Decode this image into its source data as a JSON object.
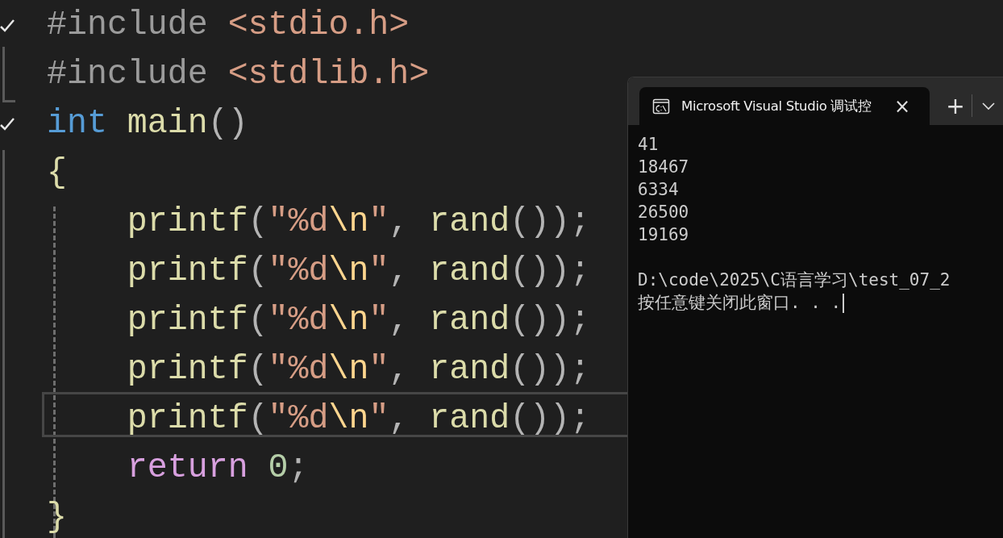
{
  "editor": {
    "lines": [
      {
        "checked": true,
        "current": false,
        "tokens": [
          {
            "kind": "preprocessor",
            "text": "#include"
          },
          {
            "kind": "string",
            "text": " <stdio.h>"
          }
        ]
      },
      {
        "checked": false,
        "current": false,
        "tokens": [
          {
            "kind": "preprocessor",
            "text": "#include"
          },
          {
            "kind": "string",
            "text": " <stdlib.h>"
          }
        ]
      },
      {
        "checked": true,
        "current": false,
        "tokens": [
          {
            "kind": "keyword",
            "text": "int"
          },
          {
            "kind": "function",
            "text": " main"
          },
          {
            "kind": "punct",
            "text": "()"
          }
        ]
      },
      {
        "checked": false,
        "current": false,
        "tokens": [
          {
            "kind": "brace",
            "text": "{"
          }
        ]
      },
      {
        "checked": false,
        "current": false,
        "tokens": [
          {
            "kind": "function",
            "text": "    printf"
          },
          {
            "kind": "punct",
            "text": "("
          },
          {
            "kind": "string",
            "text": "″%d"
          },
          {
            "kind": "escape",
            "text": "\\n"
          },
          {
            "kind": "string",
            "text": "″"
          },
          {
            "kind": "punct",
            "text": ", "
          },
          {
            "kind": "function",
            "text": "rand"
          },
          {
            "kind": "punct",
            "text": "());"
          }
        ]
      },
      {
        "checked": false,
        "current": false,
        "tokens": [
          {
            "kind": "function",
            "text": "    printf"
          },
          {
            "kind": "punct",
            "text": "("
          },
          {
            "kind": "string",
            "text": "″%d"
          },
          {
            "kind": "escape",
            "text": "\\n"
          },
          {
            "kind": "string",
            "text": "″"
          },
          {
            "kind": "punct",
            "text": ", "
          },
          {
            "kind": "function",
            "text": "rand"
          },
          {
            "kind": "punct",
            "text": "());"
          }
        ]
      },
      {
        "checked": false,
        "current": false,
        "tokens": [
          {
            "kind": "function",
            "text": "    printf"
          },
          {
            "kind": "punct",
            "text": "("
          },
          {
            "kind": "string",
            "text": "″%d"
          },
          {
            "kind": "escape",
            "text": "\\n"
          },
          {
            "kind": "string",
            "text": "″"
          },
          {
            "kind": "punct",
            "text": ", "
          },
          {
            "kind": "function",
            "text": "rand"
          },
          {
            "kind": "punct",
            "text": "());"
          }
        ]
      },
      {
        "checked": false,
        "current": false,
        "tokens": [
          {
            "kind": "function",
            "text": "    printf"
          },
          {
            "kind": "punct",
            "text": "("
          },
          {
            "kind": "string",
            "text": "″%d"
          },
          {
            "kind": "escape",
            "text": "\\n"
          },
          {
            "kind": "string",
            "text": "″"
          },
          {
            "kind": "punct",
            "text": ", "
          },
          {
            "kind": "function",
            "text": "rand"
          },
          {
            "kind": "punct",
            "text": "());"
          }
        ]
      },
      {
        "checked": false,
        "current": true,
        "tokens": [
          {
            "kind": "function",
            "text": "    printf"
          },
          {
            "kind": "punct",
            "text": "("
          },
          {
            "kind": "string",
            "text": "″%d"
          },
          {
            "kind": "escape",
            "text": "\\n"
          },
          {
            "kind": "string",
            "text": "″"
          },
          {
            "kind": "punct",
            "text": ", "
          },
          {
            "kind": "function",
            "text": "rand"
          },
          {
            "kind": "punct",
            "text": "());"
          }
        ]
      },
      {
        "checked": false,
        "current": false,
        "tokens": [
          {
            "kind": "control",
            "text": "    return"
          },
          {
            "kind": "number",
            "text": " 0"
          },
          {
            "kind": "punct",
            "text": ";"
          }
        ]
      },
      {
        "checked": false,
        "current": false,
        "tokens": [
          {
            "kind": "brace",
            "text": "}"
          }
        ]
      }
    ]
  },
  "console": {
    "tab_title": "Microsoft Visual Studio 调试控",
    "close": "×",
    "new_tab": "+",
    "output": [
      "41",
      "18467",
      "6334",
      "26500",
      "19169"
    ],
    "path": "D:\\code\\2025\\C语言学习\\test_07_2",
    "prompt": "按任意键关闭此窗口. . ."
  }
}
